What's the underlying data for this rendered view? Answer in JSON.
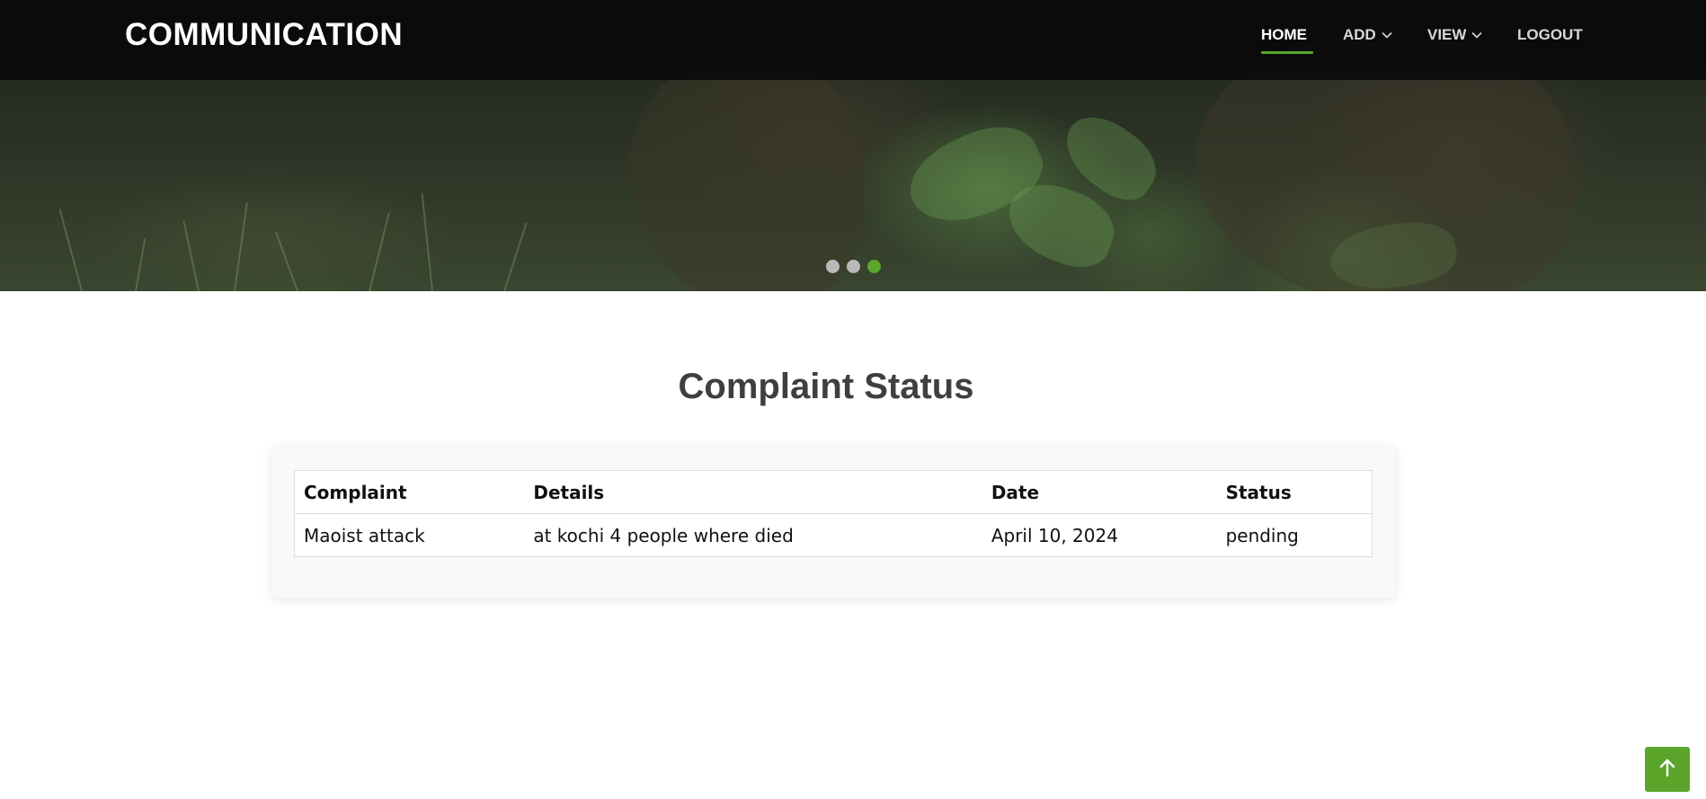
{
  "brand": {
    "title": "COMMUNICATION"
  },
  "nav": {
    "items": [
      {
        "label": "HOME",
        "active": true,
        "has_dropdown": false
      },
      {
        "label": "ADD",
        "active": false,
        "has_dropdown": true
      },
      {
        "label": "VIEW",
        "active": false,
        "has_dropdown": true
      },
      {
        "label": "LOGOUT",
        "active": false,
        "has_dropdown": false
      }
    ],
    "icons": {
      "dropdown": "chevron-down-icon"
    }
  },
  "carousel": {
    "slide_count": 3,
    "active_index": 2
  },
  "page": {
    "title": "Complaint Status"
  },
  "table": {
    "columns": [
      "Complaint",
      "Details",
      "Date",
      "Status"
    ],
    "rows": [
      [
        "Maoist attack",
        "at kochi 4 people where died",
        "April 10, 2024",
        "pending"
      ]
    ]
  },
  "back_to_top": {
    "icon": "arrow-up-icon"
  },
  "colors": {
    "accent": "#5aa52a",
    "navbar": "#080808",
    "title": "#3f3f3f"
  }
}
